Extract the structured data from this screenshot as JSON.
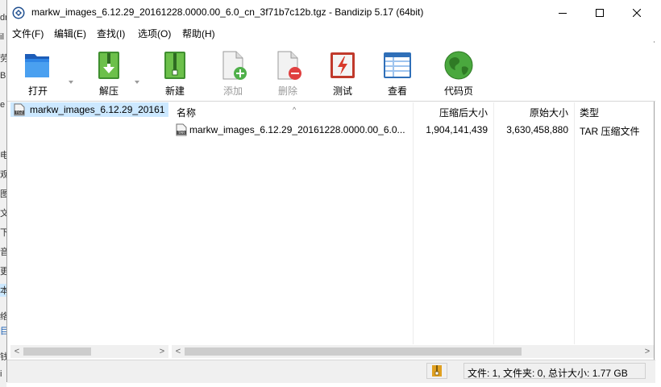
{
  "window": {
    "title": "markw_images_6.12.29_20161228.0000.00_6.0_cn_3f71b7c12b.tgz - Bandizip 5.17 (64bit)"
  },
  "menu": [
    {
      "label": "文件(F)"
    },
    {
      "label": "编辑(E)"
    },
    {
      "label": "查找(I)"
    },
    {
      "label": "选项(O)"
    },
    {
      "label": "帮助(H)"
    }
  ],
  "toolbar": [
    {
      "label": "打开",
      "icon": "folder-open-icon",
      "enabled": true
    },
    {
      "label": "解压",
      "icon": "extract-icon",
      "enabled": true
    },
    {
      "label": "新建",
      "icon": "new-archive-icon",
      "enabled": true
    },
    {
      "label": "添加",
      "icon": "add-file-icon",
      "enabled": false
    },
    {
      "label": "删除",
      "icon": "delete-file-icon",
      "enabled": false
    },
    {
      "label": "测试",
      "icon": "test-icon",
      "enabled": true
    },
    {
      "label": "查看",
      "icon": "view-icon",
      "enabled": true
    },
    {
      "label": "代码页",
      "icon": "globe-icon",
      "enabled": true
    }
  ],
  "tree": {
    "selected_item": "markw_images_6.12.29_20161"
  },
  "file_list": {
    "columns": [
      "名称",
      "压缩后大小",
      "原始大小",
      "类型"
    ],
    "rows": [
      {
        "name": "markw_images_6.12.29_20161228.0000.00_6.0...",
        "packed": "1,904,141,439",
        "original": "3,630,458,880",
        "type": "TAR 压缩文件"
      }
    ]
  },
  "status": {
    "text": "文件: 1, 文件夹: 0, 总计大小: 1.77 GB"
  },
  "background_window": {
    "fragments": [
      "dr",
      "il",
      "劳",
      "B",
      "e",
      "电",
      "观",
      "图",
      "文",
      "下",
      "音",
      "更",
      "本",
      "络",
      "目",
      "钱",
      "i"
    ]
  },
  "colors": {
    "selection": "#cce8ff",
    "chrome": "#f0f0f0"
  }
}
